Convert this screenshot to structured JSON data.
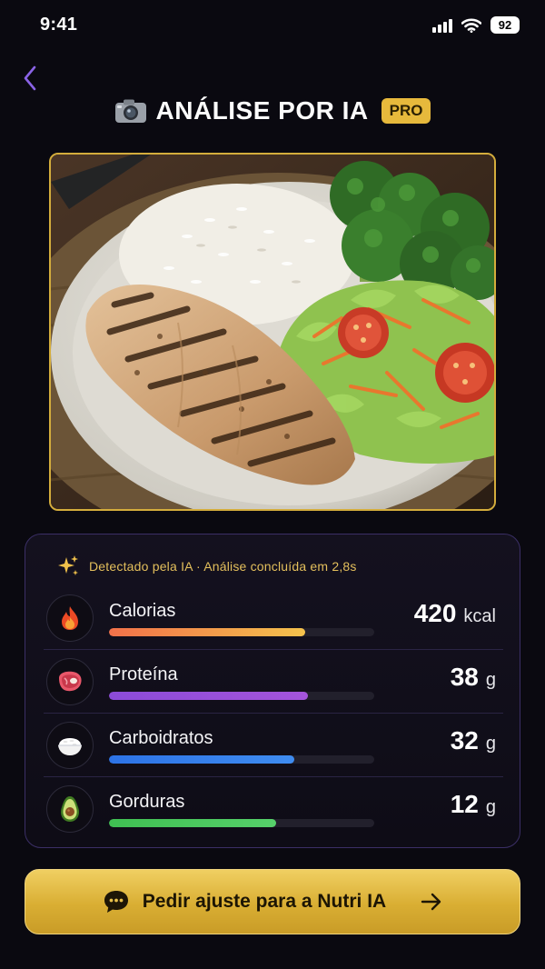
{
  "status_bar": {
    "time": "9:41",
    "battery": "92"
  },
  "header": {
    "title": "ANÁLISE POR IA",
    "badge": "PRO",
    "back_icon": "chevron-left-icon",
    "title_icon": "camera-icon"
  },
  "photo": {
    "subject": "food-photo"
  },
  "analysis": {
    "detected_text": "Detectado pela IA · Análise concluída em 2,8s",
    "icon": "sparkle-icon",
    "nutrients": [
      {
        "label": "Calorias",
        "value": "420",
        "unit": "kcal",
        "icon": "fire-icon",
        "progress": 0.74,
        "color_start": "#f2714a",
        "color_end": "#f4c24c"
      },
      {
        "label": "Proteína",
        "value": "38",
        "unit": "g",
        "icon": "meat-icon",
        "progress": 0.75,
        "color_start": "#8b4bd8",
        "color_end": "#a454db"
      },
      {
        "label": "Carboidratos",
        "value": "32",
        "unit": "g",
        "icon": "rice-bowl-icon",
        "progress": 0.7,
        "color_start": "#2d73e6",
        "color_end": "#3f8cf0"
      },
      {
        "label": "Gorduras",
        "value": "12",
        "unit": "g",
        "icon": "avocado-icon",
        "progress": 0.63,
        "color_start": "#3fbf52",
        "color_end": "#56d06a"
      }
    ]
  },
  "cta": {
    "label": "Pedir ajuste para a Nutri IA",
    "icon": "chat-bubble-icon",
    "arrow_icon": "arrow-right-icon"
  },
  "colors": {
    "background": "#0a0910",
    "accent_gold": "#e7b93c",
    "accent_purple": "#7a5bd8"
  }
}
